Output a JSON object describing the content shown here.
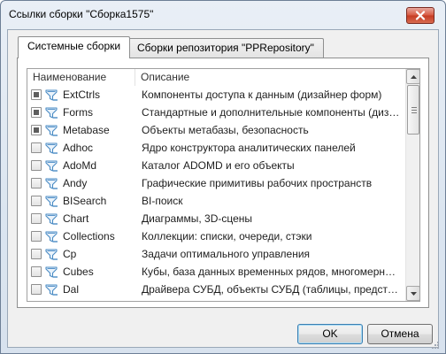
{
  "window": {
    "title": "Ссылки сборки \"Сборка1575\""
  },
  "tabs": [
    {
      "label": "Системные сборки",
      "active": true
    },
    {
      "label": "Сборки репозитория \"PPRepository\"",
      "active": false
    }
  ],
  "list": {
    "columns": {
      "name": "Наименование",
      "description": "Описание"
    },
    "rows": [
      {
        "name": "ExtCtrls",
        "description": "Компоненты доступа к данным (дизайнер форм)",
        "checked": true
      },
      {
        "name": "Forms",
        "description": "Стандартные и дополнительные компоненты (дизайнер форм)",
        "checked": true
      },
      {
        "name": "Metabase",
        "description": "Объекты метабазы, безопасность",
        "checked": true
      },
      {
        "name": "Adhoc",
        "description": "Ядро конструктора аналитических панелей",
        "checked": false
      },
      {
        "name": "AdoMd",
        "description": "Каталог ADOMD и его объекты",
        "checked": false
      },
      {
        "name": "Andy",
        "description": "Графические примитивы рабочих пространств",
        "checked": false
      },
      {
        "name": "BISearch",
        "description": "BI-поиск",
        "checked": false
      },
      {
        "name": "Chart",
        "description": "Диаграммы, 3D-сцены",
        "checked": false
      },
      {
        "name": "Collections",
        "description": "Коллекции: списки, очереди, стэки",
        "checked": false
      },
      {
        "name": "Cp",
        "description": "Задачи оптимального управления",
        "checked": false
      },
      {
        "name": "Cubes",
        "description": "Кубы, база данных временных рядов, многомерный расчёт",
        "checked": false
      },
      {
        "name": "Dal",
        "description": "Драйвера СУБД, объекты СУБД (таблицы, представления)",
        "checked": false
      }
    ]
  },
  "buttons": {
    "ok": "OK",
    "cancel": "Отмена"
  },
  "colors": {
    "accent": "#3c7fb1",
    "close": "#c53a22",
    "icon": "#4a8bc4"
  }
}
